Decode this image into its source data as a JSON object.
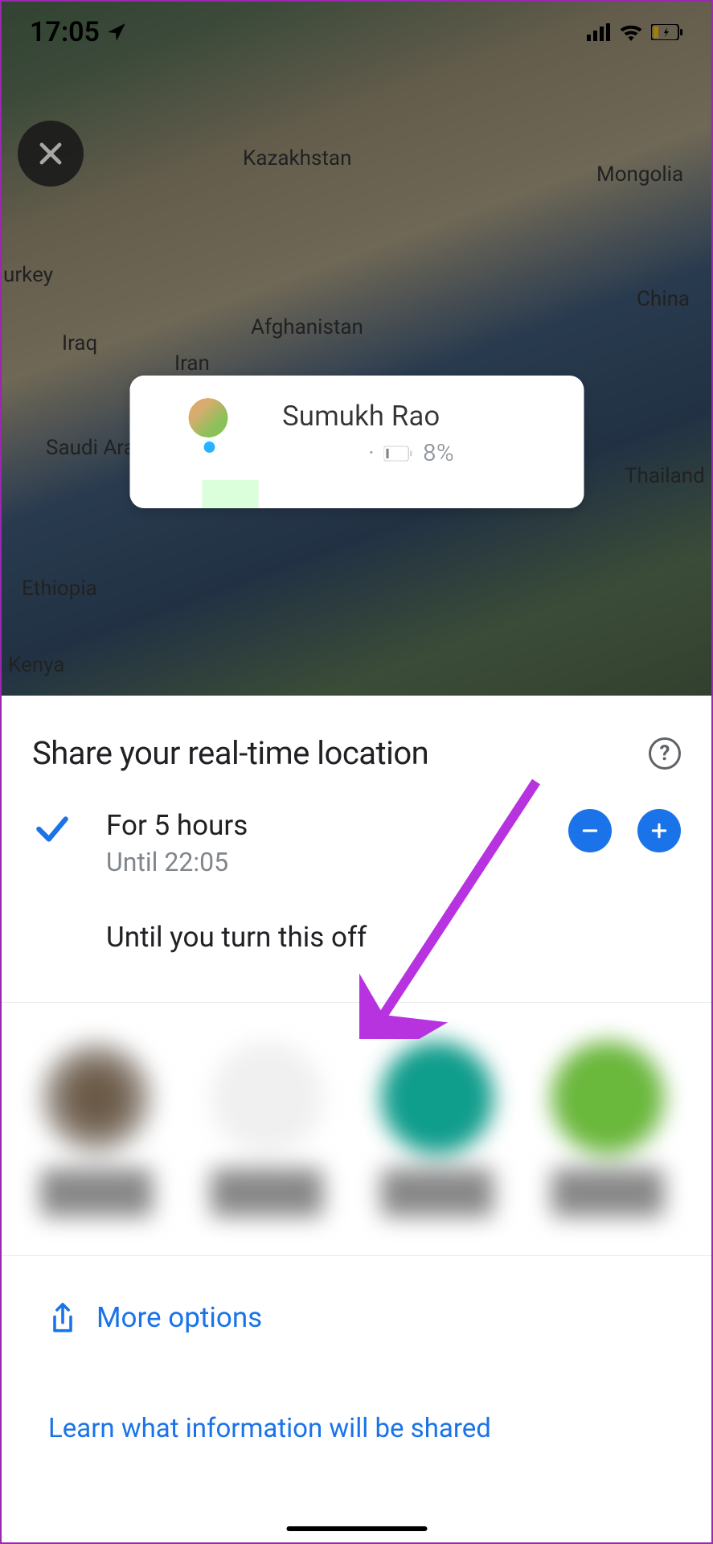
{
  "status_bar": {
    "time": "17:05"
  },
  "map": {
    "labels": {
      "kazakhstan": "Kazakhstan",
      "mongolia": "Mongolia",
      "turkey": "urkey",
      "china": "China",
      "afghanistan": "Afghanistan",
      "iraq": "Iraq",
      "iran": "Iran",
      "saudi_arabia": "Saudi Ara",
      "thailand": "Thailand",
      "ethiopia": "Ethiopia",
      "kenya": "Kenya"
    }
  },
  "location_card": {
    "name": "Sumukh Rao",
    "battery_percent": "8%"
  },
  "sheet": {
    "title": "Share your real-time location",
    "help_symbol": "?",
    "option_selected": {
      "main": "For 5 hours",
      "sub": "Until 22:05"
    },
    "option_off": "Until you turn this off",
    "more_options": "More options",
    "learn_link": "Learn what information will be shared"
  }
}
